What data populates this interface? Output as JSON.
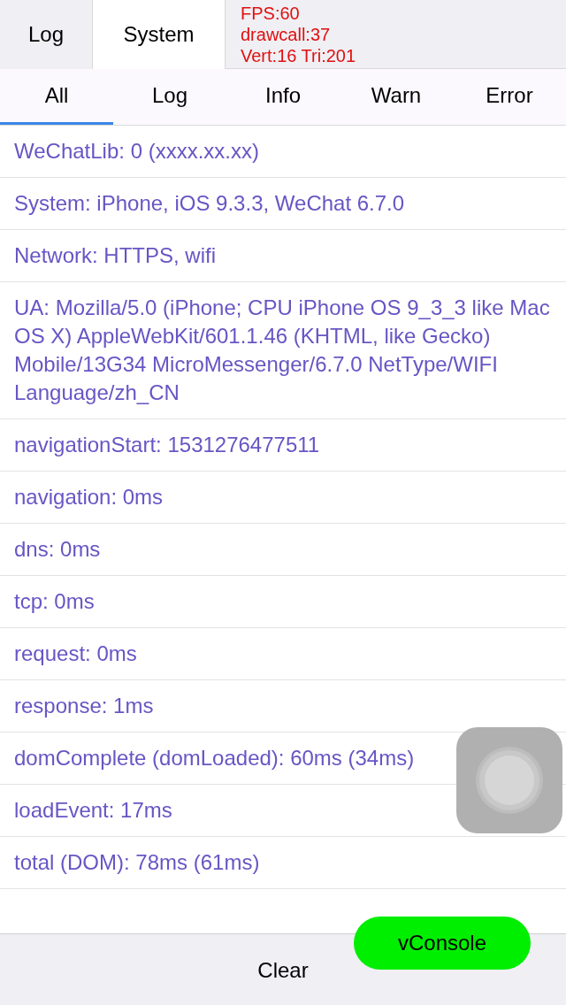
{
  "tabs": [
    {
      "label": "Log",
      "selected": false
    },
    {
      "label": "System",
      "selected": true
    }
  ],
  "filters": [
    {
      "label": "All",
      "selected": true
    },
    {
      "label": "Log",
      "selected": false
    },
    {
      "label": "Info",
      "selected": false
    },
    {
      "label": "Warn",
      "selected": false
    },
    {
      "label": "Error",
      "selected": false
    }
  ],
  "log_lines": [
    "WeChatLib: 0 (xxxx.xx.xx)",
    "System: iPhone, iOS 9.3.3, WeChat 6.7.0",
    "Network: HTTPS, wifi",
    "UA: Mozilla/5.0 (iPhone; CPU iPhone OS 9_3_3 like Mac OS X) AppleWebKit/601.1.46 (KHTML, like Gecko) Mobile/13G34 MicroMessenger/6.7.0 NetType/WIFI Language/zh_CN",
    "navigationStart: 1531276477511",
    "navigation: 0ms",
    "dns: 0ms",
    "tcp: 0ms",
    "request: 0ms",
    "response: 1ms",
    "domComplete (domLoaded): 60ms (34ms)",
    "loadEvent: 17ms",
    "total (DOM): 78ms (61ms)"
  ],
  "stats": [
    "FPS:60",
    "drawcall:37",
    "Vert:16 Tri:201"
  ],
  "footer": {
    "clear_label": "Clear"
  },
  "vconsole_button": "vConsole"
}
